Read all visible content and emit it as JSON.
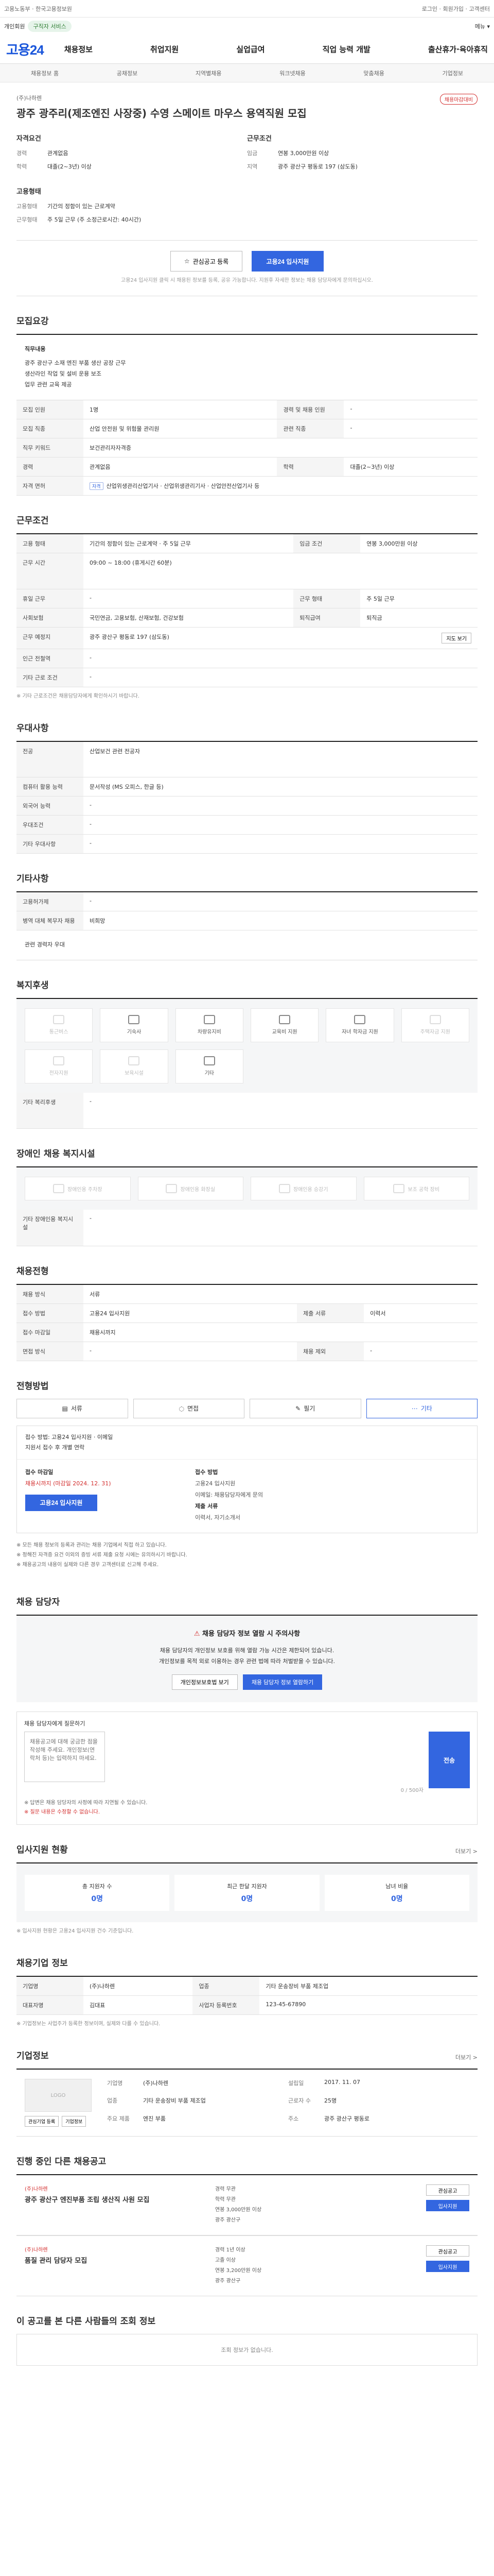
{
  "topbar": {
    "left": "고용노동부 · 한국고용정보원",
    "right": "로그인 · 회원가입 · 고객센터"
  },
  "notice": {
    "label": "개인회원",
    "pill": "구직자 서비스",
    "right": "메뉴 ▾"
  },
  "header": {
    "logo": "고용24",
    "nav": [
      "채용정보",
      "취업지원",
      "실업급여",
      "직업 능력 개발",
      "출산휴가·육아휴직"
    ]
  },
  "subnav": [
    "채용정보 홈",
    "공채정보",
    "지역별채용",
    "워크넷채용",
    "맞춤채용",
    "기업정보"
  ],
  "hero": {
    "org": "(주)나하렌",
    "title": "광주 광주리(제조엔진 사장중) 수영 스메이트 마우스 용역직원 모집",
    "badge": "채용마감대비",
    "summary": {
      "left_title": "자격요건",
      "right_title": "근무조건",
      "left": [
        {
          "k": "경력",
          "v": "관계없음"
        },
        {
          "k": "학력",
          "v": "대졸(2~3년) 이상"
        }
      ],
      "right": [
        {
          "k": "임금",
          "v": "연봉 3,000만원 이상"
        },
        {
          "k": "지역",
          "v": "광주 광산구 평동로 197 (삼도동)"
        }
      ],
      "left2_title": "고용형태",
      "left2": [
        {
          "k": "고용형태",
          "v": "기간의 정함이 있는 근로계약"
        },
        {
          "k": "근무형태",
          "v": "주 5일 근무 (주 소정근로시간: 40시간)"
        }
      ]
    },
    "cta": {
      "scrap": "관심공고 등록",
      "apply": "고용24 입사지원"
    },
    "cta_note": "고용24 입사지원 클릭 시 채용된 정보를 등록, 공유 가능합니다. 지원후 자세한 정보는 채용 담당자에게 문의하십시오."
  },
  "detail": {
    "title": "모집요강",
    "desc_head": "직무내용",
    "desc": [
      "광주 광산구 소재 엔진 부품 생산 공장 근무",
      "생산라인 작업 및 설비 운용 보조",
      "업무 관련 교육 제공"
    ],
    "rows": [
      {
        "k": "모집 인원",
        "v": "1명",
        "k2": "경력 및 채용 인원",
        "v2": "-"
      },
      {
        "k": "모집 직종",
        "v": "산업 안전원 및 위험물 관리원",
        "k2": "관련 직종",
        "v2": "-"
      },
      {
        "k": "직무 키워드",
        "v": "보건관리자자격증",
        "k2": "",
        "v2": ""
      },
      {
        "k": "경력",
        "v": "관계없음",
        "k2": "학력",
        "v2": "대졸(2~3년) 이상"
      },
      {
        "k": "자격 면허",
        "v": "산업위생관리산업기사 · 산업위생관리기사 · 산업안전산업기사 등",
        "k2": "",
        "v2": ""
      }
    ]
  },
  "work": {
    "title": "근무조건",
    "rows": [
      {
        "k": "고용 형태",
        "v": "기간의 정함이 있는 근로계약 · 주 5일 근무",
        "k2": "임금 조건",
        "v2": "연봉 3,000만원 이상"
      },
      {
        "k": "근무 시간",
        "v": "09:00 ~ 18:00 (휴게시간 60분)",
        "k2": "",
        "v2": ""
      },
      {
        "k": "휴일 근무",
        "v": "-",
        "k2": "근무 형태",
        "v2": "주 5일 근무"
      },
      {
        "k": "사회보험",
        "v": "국민연금, 고용보험, 산재보험, 건강보험",
        "k2": "퇴직급여",
        "v2": "퇴직금"
      },
      {
        "k": "근무 예정지",
        "v": "광주 광산구 평동로 197 (삼도동)",
        "k2": "",
        "v2": ""
      },
      {
        "k": "인근 전철역",
        "v": "-",
        "k2": "",
        "v2": ""
      },
      {
        "k": "기타 근로 조건",
        "v": "-",
        "k2": "",
        "v2": ""
      }
    ],
    "map_btn": "지도 보기",
    "note": "※ 기타 근로조건은 채용담당자에게 확인하시기 바랍니다."
  },
  "extra": {
    "title": "우대사항",
    "rows": [
      {
        "k": "전공",
        "v": "산업보건 관련 전공자"
      },
      {
        "k": "컴퓨터 활용 능력",
        "v": "문서작성 (MS 오피스, 한글 등)"
      },
      {
        "k": "외국어 능력",
        "v": "-"
      },
      {
        "k": "우대조건",
        "v": "-"
      },
      {
        "k": "기타 우대사항",
        "v": "-"
      }
    ]
  },
  "etc": {
    "title": "기타사항",
    "rows": [
      {
        "k": "고용허가제",
        "v": "-"
      },
      {
        "k": "병역 대체 복무자 채용",
        "v": "비희망"
      }
    ],
    "desc": "관련 경력자 우대"
  },
  "welfare": {
    "title": "복지후생",
    "items": [
      {
        "label": "통근버스",
        "on": false
      },
      {
        "label": "기숙사",
        "on": true
      },
      {
        "label": "차량유지비",
        "on": true
      },
      {
        "label": "교육비 지원",
        "on": true
      },
      {
        "label": "자녀 학자금 지원",
        "on": true
      },
      {
        "label": "주택자금 지원",
        "on": false
      },
      {
        "label": "전자지원",
        "on": false
      },
      {
        "label": "보육시설",
        "on": false
      },
      {
        "label": "기타",
        "on": true
      }
    ],
    "extra_label": "기타 복리후생",
    "extra_value": "-"
  },
  "disability": {
    "title": "장애인 채용 복지시설",
    "items": [
      "장애인용 주차장",
      "장애인용 화장실",
      "장애인용 승강기",
      "보조 공학 장비"
    ],
    "extra_label": "기타 장애인용 복지시설",
    "extra_value": "-"
  },
  "process": {
    "title": "채용전형",
    "rows": [
      {
        "k": "채용 방식",
        "v": "서류",
        "k2": "",
        "v2": ""
      },
      {
        "k": "접수 방법",
        "v": "고용24 입사지원",
        "k2": "제출 서류",
        "v2": "이력서"
      },
      {
        "k": "접수 마감일",
        "v": "채용시까지",
        "k2": "",
        "v2": ""
      },
      {
        "k": "면접 방식",
        "v": "-",
        "k2": "채용 제외",
        "v2": "-"
      }
    ]
  },
  "apply": {
    "title": "전형방법",
    "tabs": [
      "서류",
      "면접",
      "필기",
      "기타"
    ],
    "head": [
      "접수 방법: 고용24 입사지원 · 이메일",
      "지원서 접수 후 개별 연락"
    ],
    "left_label": "접수 마감일",
    "left_value": "채용시까지 (마감일 2024. 12. 31)",
    "left_btn": "고용24 입사지원",
    "right_label": "접수 방법",
    "right_items": [
      "고용24 입사지원",
      "이메일: 채용담당자에게 문의",
      "제출 서류",
      "이력서, 자기소개서"
    ],
    "notes": [
      "※ 모든 채용 정보의 등록과 관리는 채용 기업에서 직접 하고 있습니다.",
      "※ 정해진 자격증 요건 이외의 증빙 서류 제출 요청 시에는 유의하시기 바랍니다.",
      "※ 채용공고의 내용이 실제와 다른 경우 고객센터로 신고해 주세요."
    ]
  },
  "manager": {
    "title": "채용 담당자",
    "warn": "채용 담당자 정보 열람 시 주의사항",
    "desc": [
      "채용 담당자의 개인정보 보호를 위해 열람 가능 시간은 제한되어 있습니다.",
      "개인정보를 목적 외로 이용하는 경우 관련 법에 따라 처벌받을 수 있습니다."
    ],
    "btn_view": "개인정보보호법 보기",
    "btn_open": "채용 담당자 정보 열람하기"
  },
  "inquiry": {
    "label": "채용 담당자에게 질문하기",
    "placeholder": "채용공고에 대해 궁금한 점을 작성해 주세요. 개인정보(연락처 등)는 입력하지 마세요.",
    "counter": "0 / 500자",
    "send": "전송",
    "notes": [
      "※ 답변은 채용 담당자의 사정에 따라 지연될 수 있습니다.",
      "※ 질문 내용은 수정할 수 없습니다."
    ]
  },
  "stats": {
    "title": "입사지원 현황",
    "more": "더보기 >",
    "items": [
      {
        "label": "총 지원자 수",
        "value": "0명"
      },
      {
        "label": "최근 한달 지원자",
        "value": "0명"
      },
      {
        "label": "남녀 비율",
        "value": "0명"
      }
    ],
    "note": "※ 입사지원 현황은 고용24 입사지원 건수 기준입니다."
  },
  "recruit": {
    "title": "채용기업 정보",
    "rows": [
      {
        "k": "기업명",
        "v": "(주)나하렌",
        "k2": "업종",
        "v2": "기타 운송장비 부품 제조업"
      },
      {
        "k": "대표자명",
        "v": "김대표",
        "k2": "사업자 등록번호",
        "v2": "123-45-67890"
      }
    ],
    "note": "※ 기업정보는 사업주가 등록한 정보이며, 실제와 다를 수 있습니다."
  },
  "company": {
    "title": "기업정보",
    "more": "더보기 >",
    "logo": "LOGO",
    "btn1": "관심기업 등록",
    "btn2": "기업정보",
    "info": [
      {
        "k": "기업명",
        "v": "(주)나하렌"
      },
      {
        "k": "설립일",
        "v": "2017. 11. 07"
      },
      {
        "k": "업종",
        "v": "기타 운송장비 부품 제조업"
      },
      {
        "k": "근로자 수",
        "v": "25명"
      },
      {
        "k": "주요 제품",
        "v": "엔진 부품"
      },
      {
        "k": "주소",
        "v": "광주 광산구 평동로"
      }
    ]
  },
  "similar": {
    "title": "진행 중인 다른 채용공고",
    "jobs": [
      {
        "co": "(주)나하렌",
        "title": "광주 광산구 엔진부품 조립 생산직 사원 모집",
        "info": [
          "경력 무관",
          "학력 무관",
          "연봉 3,000만원 이상",
          "광주 광산구"
        ],
        "scrap": "관심공고",
        "apply": "입사지원"
      },
      {
        "co": "(주)나하렌",
        "title": "품질 관리 담당자 모집",
        "info": [
          "경력 1년 이상",
          "고졸 이상",
          "연봉 3,200만원 이상",
          "광주 광산구"
        ],
        "scrap": "관심공고",
        "apply": "입사지원"
      }
    ]
  },
  "history": {
    "title": "이 공고를 본 다른 사람들의 조회 정보",
    "empty": "조회 정보가 없습니다."
  }
}
